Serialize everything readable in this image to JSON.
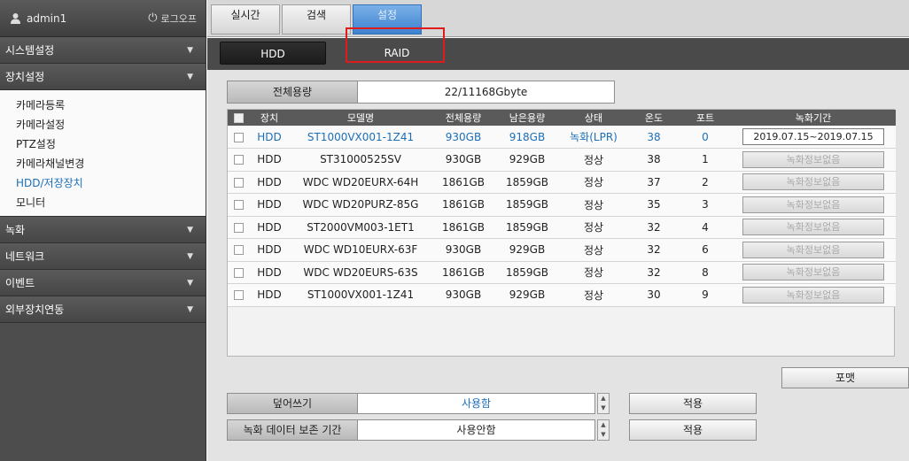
{
  "user": {
    "name": "admin1",
    "logout_label": "로그오프",
    "user_icon": "user-icon",
    "logout_icon": "power-icon"
  },
  "top_tabs": [
    {
      "label": "실시간"
    },
    {
      "label": "검색"
    },
    {
      "label": "설정",
      "active": true
    }
  ],
  "sidebar": {
    "sections": [
      {
        "label": "시스템설정"
      },
      {
        "label": "장치설정",
        "expanded": true
      },
      {
        "label": "녹화"
      },
      {
        "label": "네트워크"
      },
      {
        "label": "이벤트"
      },
      {
        "label": "외부장치연동"
      }
    ],
    "device_items": [
      {
        "label": "카메라등록"
      },
      {
        "label": "카메라설정"
      },
      {
        "label": "PTZ설정"
      },
      {
        "label": "카메라채널변경"
      },
      {
        "label": "HDD/저장장치",
        "active": true
      },
      {
        "label": "모니터"
      }
    ]
  },
  "subtabs": [
    {
      "label": "HDD",
      "active": true
    },
    {
      "label": "RAID"
    }
  ],
  "capacity": {
    "label": "전체용량",
    "value": "22/11168Gbyte"
  },
  "table": {
    "headers": [
      "장치",
      "모델명",
      "전체용량",
      "남은용량",
      "상태",
      "온도",
      "포트",
      "녹화기간"
    ],
    "rows": [
      {
        "device": "HDD",
        "model": "ST1000VX001-1Z41",
        "total": "930GB",
        "free": "918GB",
        "status": "녹화(LPR)",
        "temp": "38",
        "port": "0",
        "period": "2019.07.15~2019.07.15",
        "highlight": true
      },
      {
        "device": "HDD",
        "model": "ST31000525SV",
        "total": "930GB",
        "free": "929GB",
        "status": "정상",
        "temp": "38",
        "port": "1",
        "period": "녹화정보없음"
      },
      {
        "device": "HDD",
        "model": "WDC WD20EURX-64H",
        "total": "1861GB",
        "free": "1859GB",
        "status": "정상",
        "temp": "37",
        "port": "2",
        "period": "녹화정보없음"
      },
      {
        "device": "HDD",
        "model": "WDC WD20PURZ-85G",
        "total": "1861GB",
        "free": "1859GB",
        "status": "정상",
        "temp": "35",
        "port": "3",
        "period": "녹화정보없음"
      },
      {
        "device": "HDD",
        "model": "ST2000VM003-1ET1",
        "total": "1861GB",
        "free": "1859GB",
        "status": "정상",
        "temp": "32",
        "port": "4",
        "period": "녹화정보없음"
      },
      {
        "device": "HDD",
        "model": "WDC WD10EURX-63F",
        "total": "930GB",
        "free": "929GB",
        "status": "정상",
        "temp": "32",
        "port": "6",
        "period": "녹화정보없음"
      },
      {
        "device": "HDD",
        "model": "WDC WD20EURS-63S",
        "total": "1861GB",
        "free": "1859GB",
        "status": "정상",
        "temp": "32",
        "port": "8",
        "period": "녹화정보없음"
      },
      {
        "device": "HDD",
        "model": "ST1000VX001-1Z41",
        "total": "930GB",
        "free": "929GB",
        "status": "정상",
        "temp": "30",
        "port": "9",
        "period": "녹화정보없음"
      }
    ]
  },
  "format_label": "포맷",
  "options": [
    {
      "label": "덮어쓰기",
      "value": "사용함",
      "apply": "적용"
    },
    {
      "label": "녹화 데이터 보존 기간",
      "value": "사용안함",
      "apply": "적용"
    }
  ],
  "colors": {
    "accent": "#1b6fb8",
    "active_tab": "#3d82cf",
    "highlight_box": "#e01b1b"
  }
}
